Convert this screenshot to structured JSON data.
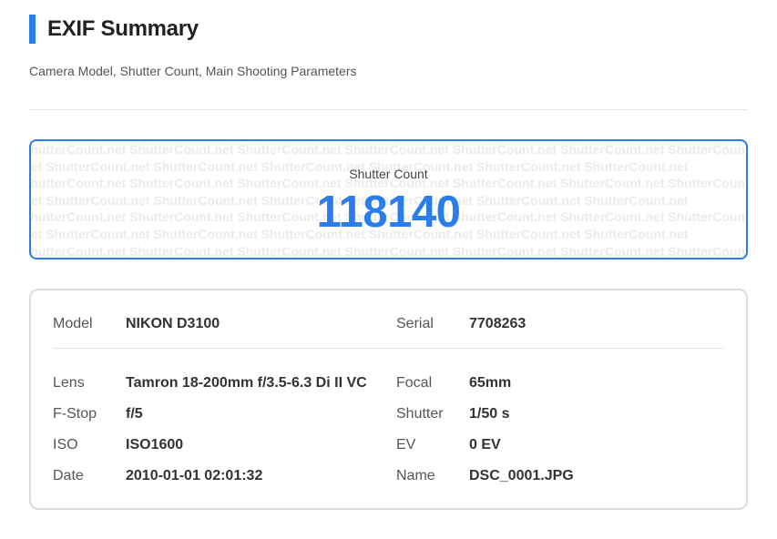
{
  "header": {
    "title": "EXIF Summary",
    "subtitle": "Camera Model, Shutter Count, Main Shooting Parameters",
    "accent_color": "#2b7de9"
  },
  "shutter": {
    "label": "Shutter Count",
    "value": "118140",
    "watermark_text": "ShutterCount.net ShutterCount.net ShutterCount.net ShutterCount.net ShutterCount.net ShutterCount.net ShutterCount.net"
  },
  "details": {
    "model": {
      "label": "Model",
      "value": "NIKON D3100"
    },
    "serial": {
      "label": "Serial",
      "value": "7708263"
    },
    "lens": {
      "label": "Lens",
      "value": "Tamron 18-200mm f/3.5-6.3 Di II VC"
    },
    "focal": {
      "label": "Focal",
      "value": "65mm"
    },
    "fstop": {
      "label": "F-Stop",
      "value": "f/5"
    },
    "shutter": {
      "label": "Shutter",
      "value": "1/50 s"
    },
    "iso": {
      "label": "ISO",
      "value": "ISO1600"
    },
    "ev": {
      "label": "EV",
      "value": "0 EV"
    },
    "date": {
      "label": "Date",
      "value": "2010-01-01 02:01:32"
    },
    "name": {
      "label": "Name",
      "value": "DSC_0001.JPG"
    }
  }
}
